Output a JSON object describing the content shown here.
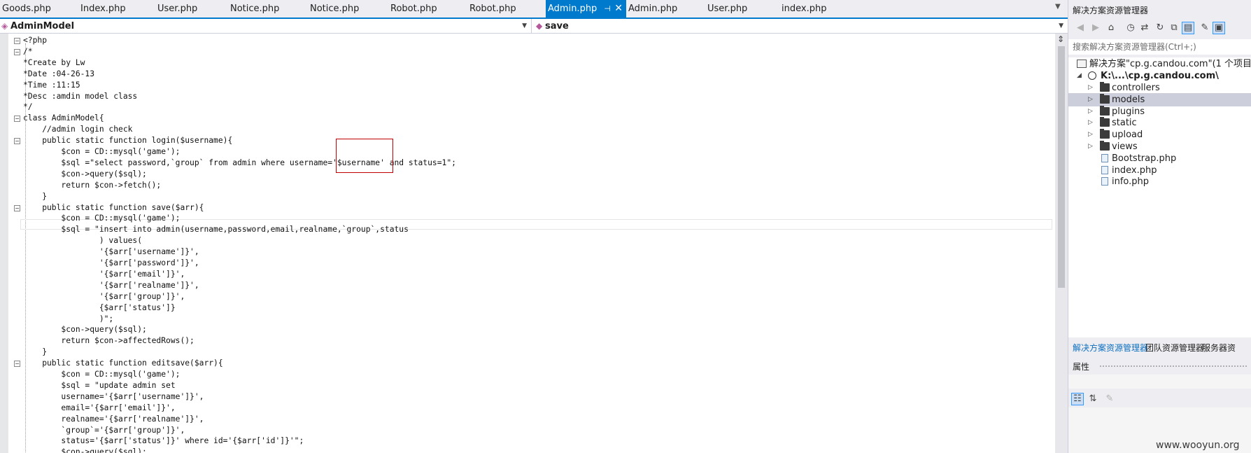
{
  "tabs": [
    {
      "label": "Goods.php",
      "active": false
    },
    {
      "label": "Index.php",
      "active": false
    },
    {
      "label": "User.php",
      "active": false
    },
    {
      "label": "Notice.php",
      "active": false
    },
    {
      "label": "Notice.php",
      "active": false
    },
    {
      "label": "Robot.php",
      "active": false
    },
    {
      "label": "Robot.php",
      "active": false
    },
    {
      "label": "Admin.php",
      "active": true
    },
    {
      "label": "Admin.php",
      "active": false
    },
    {
      "label": "User.php",
      "active": false
    },
    {
      "label": "index.php",
      "active": false
    }
  ],
  "nav": {
    "class_dropdown": "AdminModel",
    "member_dropdown": "save"
  },
  "code_lines": [
    "<?php",
    "/*",
    "*Create by Lw",
    "*Date :04-26-13",
    "*Time :11:15",
    "*Desc :amdin model class",
    "*/",
    "class AdminModel{",
    "    //admin login check",
    "    public static function login($username){",
    "        $con = CD::mysql('game');",
    "        $sql =\"select password,`group` from admin where username='$username' and status=1\";",
    "        $con->query($sql);",
    "        return $con->fetch();",
    "    }",
    "    public static function save($arr){",
    "        $con = CD::mysql('game');",
    "        $sql = \"insert into admin(username,password,email,realname,`group`,status",
    "                ) values(",
    "                '{$arr['username']}',",
    "                '{$arr['password']}',",
    "                '{$arr['email']}',",
    "                '{$arr['realname']}',",
    "                '{$arr['group']}',",
    "                {$arr['status']}",
    "                )\";",
    "        $con->query($sql);",
    "        return $con->affectedRows();",
    "    }",
    "    public static function editsave($arr){",
    "        $con = CD::mysql('game');",
    "        $sql = \"update admin set",
    "        username='{$arr['username']}',",
    "        email='{$arr['email']}',",
    "        realname='{$arr['realname']}',",
    "        `group`='{$arr['group']}',",
    "        status='{$arr['status']}' where id='{$arr['id']}'\";",
    "        $con->query($sql);"
  ],
  "fold_markers": [
    0,
    1,
    7,
    9,
    15,
    29
  ],
  "solution_explorer": {
    "title": "解决方案资源管理器",
    "search_placeholder": "搜索解决方案资源管理器(Ctrl+;)",
    "solution_label": "解决方案\"cp.g.candou.com\"(1 个项目)",
    "project_label": "K:\\...\\cp.g.candou.com\\",
    "items": [
      {
        "label": "controllers",
        "kind": "folder",
        "selected": false
      },
      {
        "label": "models",
        "kind": "folder",
        "selected": true
      },
      {
        "label": "plugins",
        "kind": "folder",
        "selected": false
      },
      {
        "label": "static",
        "kind": "folder",
        "selected": false
      },
      {
        "label": "upload",
        "kind": "folder",
        "selected": false
      },
      {
        "label": "views",
        "kind": "folder",
        "selected": false
      },
      {
        "label": "Bootstrap.php",
        "kind": "file",
        "selected": false
      },
      {
        "label": "index.php",
        "kind": "file",
        "selected": false
      },
      {
        "label": "info.php",
        "kind": "file",
        "selected": false
      }
    ]
  },
  "panel_tabs": [
    "解决方案资源管理器",
    "团队资源管理器",
    "服务器资"
  ],
  "properties": {
    "title": "属性"
  },
  "watermark": "www.wooyun.org",
  "colors": {
    "accent": "#007acc",
    "highlight_box": "#c00000",
    "selected_row": "#cccedb"
  }
}
